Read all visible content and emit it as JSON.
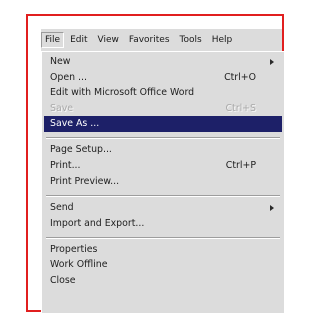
{
  "menubar": {
    "items": [
      "File",
      "Edit",
      "View",
      "Favorites",
      "Tools",
      "Help"
    ]
  },
  "menu": {
    "items": {
      "new": {
        "label": "New"
      },
      "open": {
        "label": "Open ...",
        "shortcut": "Ctrl+O"
      },
      "edit_word": {
        "label": "Edit with Microsoft Office Word"
      },
      "save": {
        "label": "Save",
        "shortcut": "Ctrl+S",
        "state": "disabled"
      },
      "save_as": {
        "label": "Save As ...",
        "state": "highlighted"
      },
      "page_setup": {
        "label": "Page Setup..."
      },
      "print": {
        "label": "Print...",
        "shortcut": "Ctrl+P"
      },
      "print_preview": {
        "label": "Print Preview..."
      },
      "send": {
        "label": "Send"
      },
      "import_export": {
        "label": "Import and Export..."
      },
      "properties": {
        "label": "Properties"
      },
      "work_offline": {
        "label": "Work Offline"
      },
      "close": {
        "label": "Close"
      }
    }
  },
  "colors": {
    "frame_border": "#e11f1f",
    "menu_background": "#dcdcdc",
    "selection_background": "#1d2068",
    "selection_text": "#ffffff",
    "disabled_text": "#a9a9a9"
  }
}
